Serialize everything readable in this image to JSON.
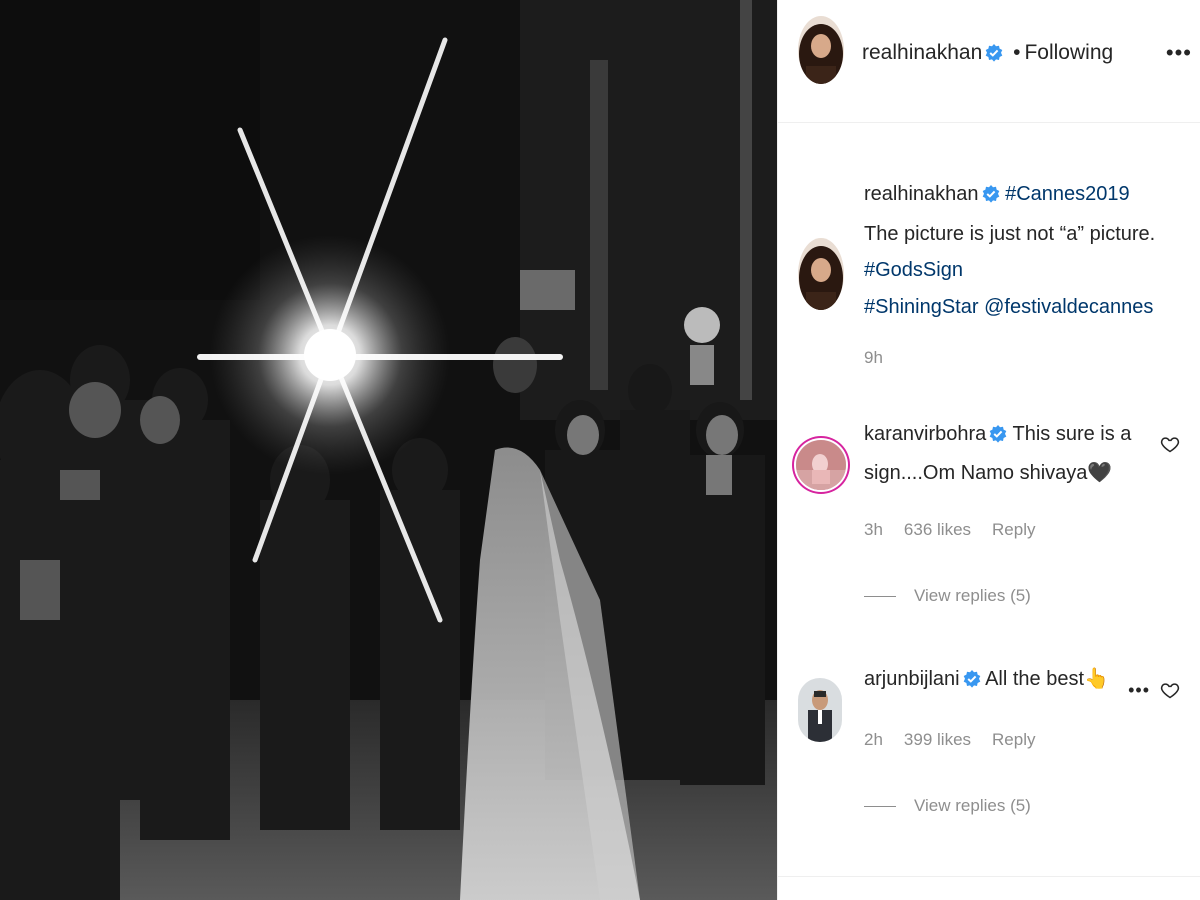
{
  "post": {
    "username": "realhinakhan",
    "follow_status": "Following",
    "separator": "•",
    "caption": {
      "hashtag1": "#Cannes2019",
      "text": "The picture is just not “a” picture.",
      "hashtag2": "#GodsSign",
      "hashtag3": "#ShiningStar",
      "mention": "@festivaldecannes",
      "time": "9h"
    }
  },
  "comments": [
    {
      "username": "karanvirbohra",
      "text": "This sure is a sign....Om Namo shivaya🖤",
      "time": "3h",
      "likes": "636 likes",
      "reply_label": "Reply",
      "view_replies": "View replies (5)"
    },
    {
      "username": "arjunbijlani",
      "text": "All the best👆",
      "time": "2h",
      "likes": "399 likes",
      "reply_label": "Reply",
      "view_replies": "View replies (5)"
    }
  ],
  "icons": {
    "more": "more-horizontal-icon",
    "verified": "verified-badge-icon",
    "like": "heart-outline-icon"
  },
  "colors": {
    "verified_blue": "#3897f0",
    "link": "#00376b",
    "muted": "#8e8e8e",
    "story_ring": "#d6249f"
  }
}
